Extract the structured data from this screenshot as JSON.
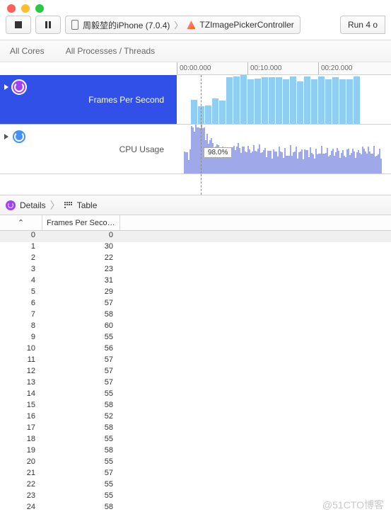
{
  "toolbar": {
    "device": "周毅堃的iPhone (7.0.4)",
    "app": "TZImagePickerController",
    "run_label": "Run 4 o"
  },
  "filters": {
    "cores": "All Cores",
    "procs": "All Processes / Threads"
  },
  "ruler": {
    "t0": "00:00.000",
    "t1": "00:10.000",
    "t2": "00:20.000"
  },
  "tracks": {
    "fps_label": "Frames Per Second",
    "cpu_label": "CPU Usage",
    "cpu_tooltip": "98.0%"
  },
  "pathbar": {
    "details": "Details",
    "table": "Table"
  },
  "table": {
    "col1_sort_icon": "⌃",
    "col2": "Frames Per Seco…",
    "rows": [
      {
        "i": "0",
        "v": "0"
      },
      {
        "i": "1",
        "v": "30"
      },
      {
        "i": "2",
        "v": "22"
      },
      {
        "i": "3",
        "v": "23"
      },
      {
        "i": "4",
        "v": "31"
      },
      {
        "i": "5",
        "v": "29"
      },
      {
        "i": "6",
        "v": "57"
      },
      {
        "i": "7",
        "v": "58"
      },
      {
        "i": "8",
        "v": "60"
      },
      {
        "i": "9",
        "v": "55"
      },
      {
        "i": "10",
        "v": "56"
      },
      {
        "i": "11",
        "v": "57"
      },
      {
        "i": "12",
        "v": "57"
      },
      {
        "i": "13",
        "v": "57"
      },
      {
        "i": "14",
        "v": "55"
      },
      {
        "i": "15",
        "v": "58"
      },
      {
        "i": "16",
        "v": "52"
      },
      {
        "i": "17",
        "v": "58"
      },
      {
        "i": "18",
        "v": "55"
      },
      {
        "i": "19",
        "v": "58"
      },
      {
        "i": "20",
        "v": "55"
      },
      {
        "i": "21",
        "v": "57"
      },
      {
        "i": "22",
        "v": "55"
      },
      {
        "i": "23",
        "v": "55"
      },
      {
        "i": "24",
        "v": "58"
      }
    ]
  },
  "chart_data": [
    {
      "type": "bar",
      "title": "Frames Per Second",
      "x_unit": "seconds",
      "ylim": [
        0,
        60
      ],
      "values": [
        0,
        30,
        22,
        23,
        31,
        29,
        57,
        58,
        60,
        55,
        56,
        57,
        57,
        57,
        55,
        58,
        52,
        58,
        55,
        58,
        55,
        57,
        55,
        55,
        58
      ]
    },
    {
      "type": "area",
      "title": "CPU Usage",
      "x_unit": "seconds",
      "y_unit": "percent",
      "ylim": [
        0,
        100
      ],
      "playhead_value": 98.0,
      "values": [
        0,
        95,
        98,
        70,
        55,
        50,
        45,
        55,
        50,
        48,
        50,
        45,
        42,
        45,
        40,
        45,
        42,
        45,
        40,
        45,
        42,
        45,
        40,
        45,
        42,
        48,
        45,
        40
      ]
    }
  ],
  "watermark": "@51CTO博客"
}
